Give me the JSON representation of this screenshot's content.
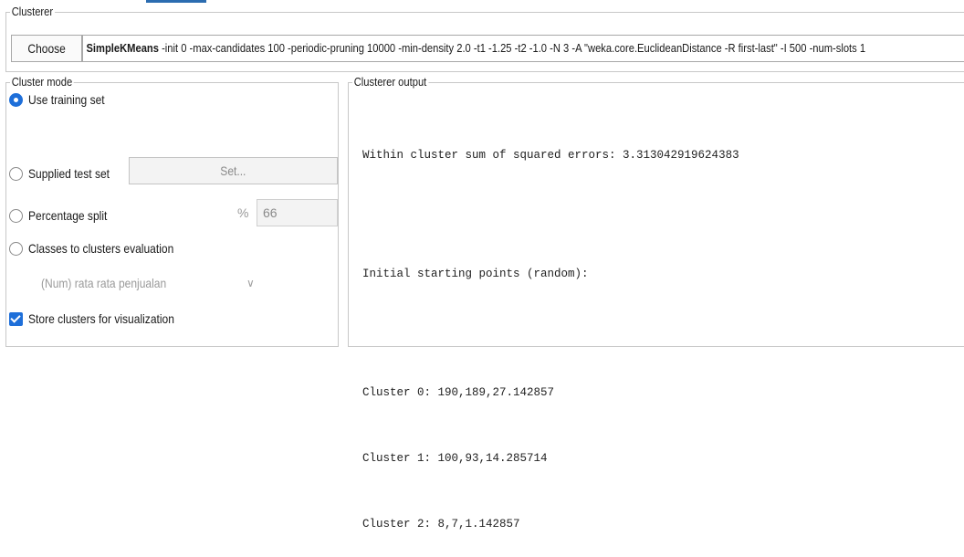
{
  "clusterer": {
    "title": "Clusterer",
    "choose_label": "Choose",
    "algorithm_name": "SimpleKMeans",
    "algorithm_options": " -init 0 -max-candidates 100 -periodic-pruning 10000 -min-density 2.0 -t1 -1.25 -t2 -1.0 -N 3 -A \"weka.core.EuclideanDistance -R first-last\" -I 500 -num-slots 1"
  },
  "cluster_mode": {
    "title": "Cluster mode",
    "options": [
      {
        "label": "Use training set",
        "selected": true
      },
      {
        "label": "Supplied test set",
        "selected": false
      },
      {
        "label": "Percentage split",
        "selected": false
      },
      {
        "label": "Classes to clusters evaluation",
        "selected": false
      }
    ],
    "set_label": "Set...",
    "percent_symbol": "%",
    "percent_value": "66",
    "class_attribute": "(Num) rata rata penjualan",
    "store_clusters_label": "Store clusters for visualization",
    "store_clusters_checked": true
  },
  "output": {
    "title": "Clusterer output",
    "lines": [
      "Within cluster sum of squared errors: 3.313042919624383",
      "",
      "Initial starting points (random):",
      "",
      "Cluster 0: 190,189,27.142857",
      "Cluster 1: 100,93,14.285714",
      "Cluster 2: 8,7,1.142857"
    ]
  },
  "colors": {
    "accent": "#1e6fd9",
    "tab_indicator": "#2b6cb0",
    "border": "#c8c8c8",
    "disabled_text": "#8a8a8a"
  },
  "icons": {
    "class_select_chevron": "chevron-down-icon",
    "store_checkbox": "checkmark-icon"
  }
}
